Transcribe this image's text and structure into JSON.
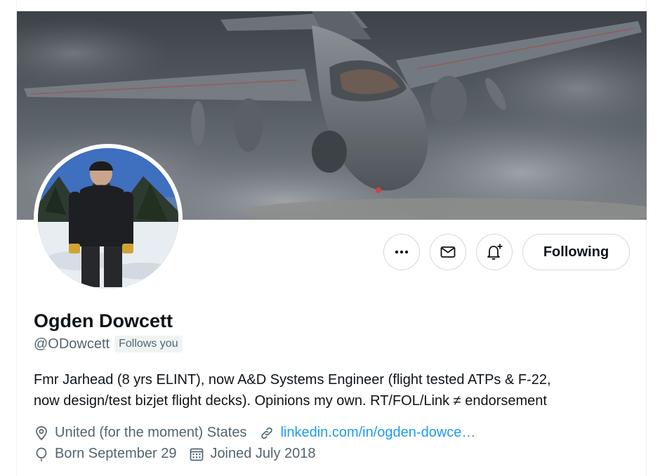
{
  "profile": {
    "display_name": "Ogden Dowcett",
    "handle": "@ODowcett",
    "follows_you_badge": "Follows you",
    "bio_line_1": "Fmr Jarhead (8 yrs ELINT), now A&D Systems Engineer (flight tested ATPs & F-22,",
    "bio_line_2": "now design/test bizjet flight decks). Opinions my own. RT/FOL/Link ≠ endorsement",
    "location": "United (for the moment) States",
    "website": "linkedin.com/in/ogden-dowce…",
    "birthday": "Born September 29",
    "joined": "Joined July 2018"
  },
  "actions": {
    "more_icon": "more-dots-icon",
    "message_icon": "envelope-icon",
    "notify_icon": "bell-plus-icon",
    "follow_label": "Following"
  },
  "icons": {
    "location": "location-pin-icon",
    "link": "link-icon",
    "birthday": "balloon-icon",
    "joined": "calendar-icon"
  },
  "colors": {
    "text_primary": "#0f1419",
    "text_secondary": "#536471",
    "link": "#1d9bf0",
    "border": "#cfd9de",
    "badge_bg": "#eff3f4"
  }
}
